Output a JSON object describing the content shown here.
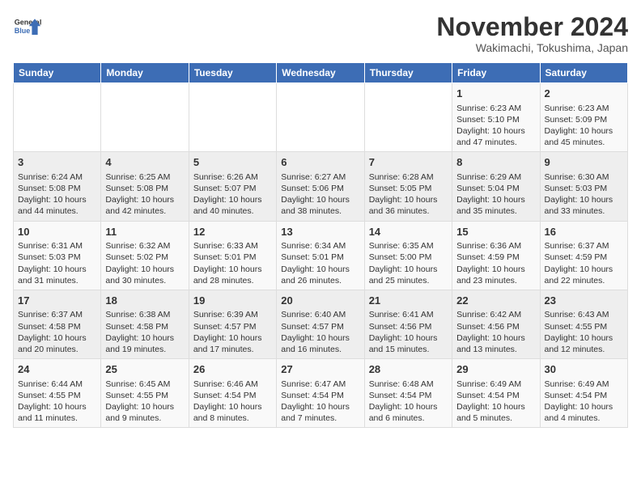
{
  "header": {
    "logo_line1": "General",
    "logo_line2": "Blue",
    "month_title": "November 2024",
    "location": "Wakimachi, Tokushima, Japan"
  },
  "weekdays": [
    "Sunday",
    "Monday",
    "Tuesday",
    "Wednesday",
    "Thursday",
    "Friday",
    "Saturday"
  ],
  "weeks": [
    [
      {
        "day": "",
        "info": ""
      },
      {
        "day": "",
        "info": ""
      },
      {
        "day": "",
        "info": ""
      },
      {
        "day": "",
        "info": ""
      },
      {
        "day": "",
        "info": ""
      },
      {
        "day": "1",
        "info": "Sunrise: 6:23 AM\nSunset: 5:10 PM\nDaylight: 10 hours and 47 minutes."
      },
      {
        "day": "2",
        "info": "Sunrise: 6:23 AM\nSunset: 5:09 PM\nDaylight: 10 hours and 45 minutes."
      }
    ],
    [
      {
        "day": "3",
        "info": "Sunrise: 6:24 AM\nSunset: 5:08 PM\nDaylight: 10 hours and 44 minutes."
      },
      {
        "day": "4",
        "info": "Sunrise: 6:25 AM\nSunset: 5:08 PM\nDaylight: 10 hours and 42 minutes."
      },
      {
        "day": "5",
        "info": "Sunrise: 6:26 AM\nSunset: 5:07 PM\nDaylight: 10 hours and 40 minutes."
      },
      {
        "day": "6",
        "info": "Sunrise: 6:27 AM\nSunset: 5:06 PM\nDaylight: 10 hours and 38 minutes."
      },
      {
        "day": "7",
        "info": "Sunrise: 6:28 AM\nSunset: 5:05 PM\nDaylight: 10 hours and 36 minutes."
      },
      {
        "day": "8",
        "info": "Sunrise: 6:29 AM\nSunset: 5:04 PM\nDaylight: 10 hours and 35 minutes."
      },
      {
        "day": "9",
        "info": "Sunrise: 6:30 AM\nSunset: 5:03 PM\nDaylight: 10 hours and 33 minutes."
      }
    ],
    [
      {
        "day": "10",
        "info": "Sunrise: 6:31 AM\nSunset: 5:03 PM\nDaylight: 10 hours and 31 minutes."
      },
      {
        "day": "11",
        "info": "Sunrise: 6:32 AM\nSunset: 5:02 PM\nDaylight: 10 hours and 30 minutes."
      },
      {
        "day": "12",
        "info": "Sunrise: 6:33 AM\nSunset: 5:01 PM\nDaylight: 10 hours and 28 minutes."
      },
      {
        "day": "13",
        "info": "Sunrise: 6:34 AM\nSunset: 5:01 PM\nDaylight: 10 hours and 26 minutes."
      },
      {
        "day": "14",
        "info": "Sunrise: 6:35 AM\nSunset: 5:00 PM\nDaylight: 10 hours and 25 minutes."
      },
      {
        "day": "15",
        "info": "Sunrise: 6:36 AM\nSunset: 4:59 PM\nDaylight: 10 hours and 23 minutes."
      },
      {
        "day": "16",
        "info": "Sunrise: 6:37 AM\nSunset: 4:59 PM\nDaylight: 10 hours and 22 minutes."
      }
    ],
    [
      {
        "day": "17",
        "info": "Sunrise: 6:37 AM\nSunset: 4:58 PM\nDaylight: 10 hours and 20 minutes."
      },
      {
        "day": "18",
        "info": "Sunrise: 6:38 AM\nSunset: 4:58 PM\nDaylight: 10 hours and 19 minutes."
      },
      {
        "day": "19",
        "info": "Sunrise: 6:39 AM\nSunset: 4:57 PM\nDaylight: 10 hours and 17 minutes."
      },
      {
        "day": "20",
        "info": "Sunrise: 6:40 AM\nSunset: 4:57 PM\nDaylight: 10 hours and 16 minutes."
      },
      {
        "day": "21",
        "info": "Sunrise: 6:41 AM\nSunset: 4:56 PM\nDaylight: 10 hours and 15 minutes."
      },
      {
        "day": "22",
        "info": "Sunrise: 6:42 AM\nSunset: 4:56 PM\nDaylight: 10 hours and 13 minutes."
      },
      {
        "day": "23",
        "info": "Sunrise: 6:43 AM\nSunset: 4:55 PM\nDaylight: 10 hours and 12 minutes."
      }
    ],
    [
      {
        "day": "24",
        "info": "Sunrise: 6:44 AM\nSunset: 4:55 PM\nDaylight: 10 hours and 11 minutes."
      },
      {
        "day": "25",
        "info": "Sunrise: 6:45 AM\nSunset: 4:55 PM\nDaylight: 10 hours and 9 minutes."
      },
      {
        "day": "26",
        "info": "Sunrise: 6:46 AM\nSunset: 4:54 PM\nDaylight: 10 hours and 8 minutes."
      },
      {
        "day": "27",
        "info": "Sunrise: 6:47 AM\nSunset: 4:54 PM\nDaylight: 10 hours and 7 minutes."
      },
      {
        "day": "28",
        "info": "Sunrise: 6:48 AM\nSunset: 4:54 PM\nDaylight: 10 hours and 6 minutes."
      },
      {
        "day": "29",
        "info": "Sunrise: 6:49 AM\nSunset: 4:54 PM\nDaylight: 10 hours and 5 minutes."
      },
      {
        "day": "30",
        "info": "Sunrise: 6:49 AM\nSunset: 4:54 PM\nDaylight: 10 hours and 4 minutes."
      }
    ]
  ]
}
